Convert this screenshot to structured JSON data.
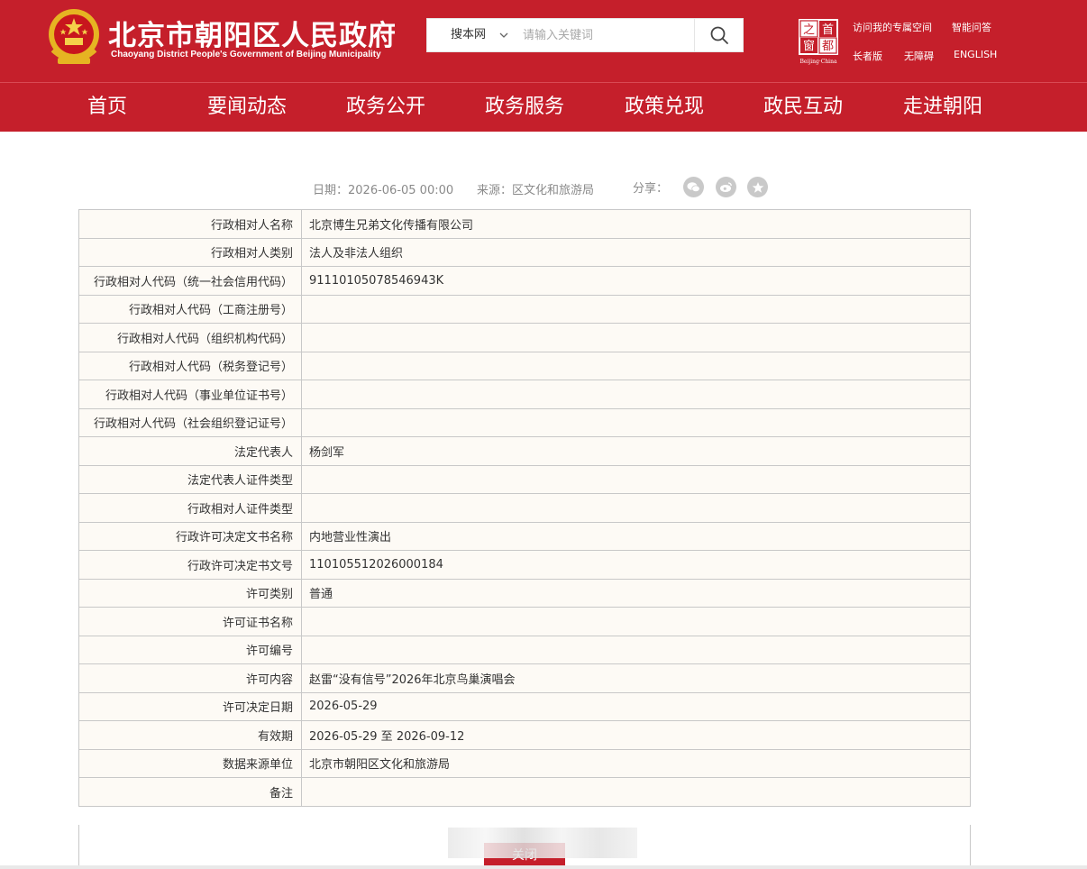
{
  "header": {
    "title": "北京市朝阳区人民政府",
    "subtitle": "Chaoyang District People's Government of Beijing Municipality",
    "capital_logo_chars": [
      "之",
      "首",
      "窗",
      "都"
    ],
    "capital_logo_caption": "Beijing·China",
    "search": {
      "scope": "搜本网",
      "placeholder": "请输入关键词"
    },
    "links": {
      "my_space": "访问我的专属空间",
      "qa": "智能问答",
      "elder": "长者版",
      "accessible": "无障碍",
      "english": "ENGLISH"
    },
    "brand_color": "#c51f2b"
  },
  "nav": [
    "首页",
    "要闻动态",
    "政务公开",
    "政务服务",
    "政策兑现",
    "政民互动",
    "走进朝阳"
  ],
  "meta": {
    "date": "日期：2026-06-05 00:00",
    "source": "来源：区文化和旅游局",
    "share_label": "分享：",
    "share_icons": [
      "wechat-icon",
      "weibo-icon",
      "favorite-icon"
    ]
  },
  "rows": [
    {
      "label": "行政相对人名称",
      "value": "北京博生兄弟文化传播有限公司"
    },
    {
      "label": "行政相对人类别",
      "value": "法人及非法人组织"
    },
    {
      "label": "行政相对人代码（统一社会信用代码）",
      "value": "91110105078546943K"
    },
    {
      "label": "行政相对人代码（工商注册号）",
      "value": ""
    },
    {
      "label": "行政相对人代码（组织机构代码）",
      "value": ""
    },
    {
      "label": "行政相对人代码（税务登记号）",
      "value": ""
    },
    {
      "label": "行政相对人代码（事业单位证书号）",
      "value": ""
    },
    {
      "label": "行政相对人代码（社会组织登记证号）",
      "value": ""
    },
    {
      "label": "法定代表人",
      "value": "杨剑军"
    },
    {
      "label": "法定代表人证件类型",
      "value": ""
    },
    {
      "label": "行政相对人证件类型",
      "value": ""
    },
    {
      "label": "行政许可决定文书名称",
      "value": "内地营业性演出"
    },
    {
      "label": "行政许可决定书文号",
      "value": "110105512026000184"
    },
    {
      "label": "许可类别",
      "value": "普通"
    },
    {
      "label": "许可证书名称",
      "value": ""
    },
    {
      "label": "许可编号",
      "value": ""
    },
    {
      "label": "许可内容",
      "value": "赵雷“没有信号”2026年北京鸟巢演唱会"
    },
    {
      "label": "许可决定日期",
      "value": "2026-05-29"
    },
    {
      "label": "有效期",
      "value": "2026-05-29 至 2026-09-12"
    },
    {
      "label": "数据来源单位",
      "value": "北京市朝阳区文化和旅游局"
    },
    {
      "label": "备注",
      "value": ""
    }
  ],
  "close_label": "关闭"
}
